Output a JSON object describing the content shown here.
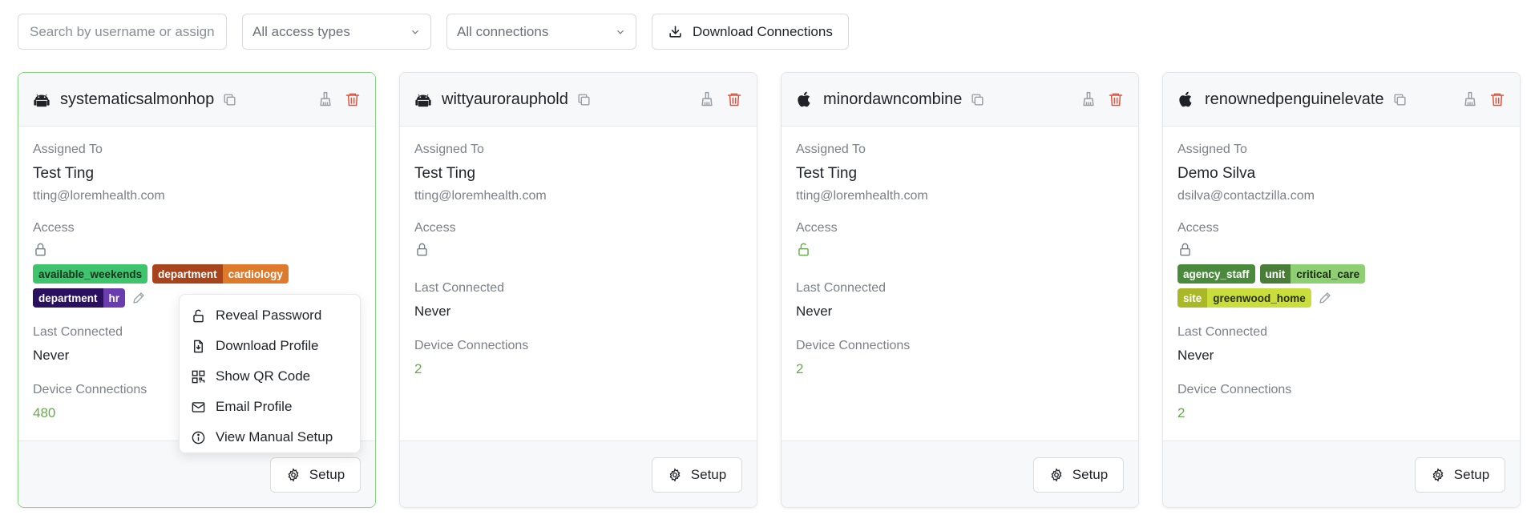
{
  "toolbar": {
    "search_placeholder": "Search by username or assignee",
    "access_select": "All access types",
    "connections_select": "All connections",
    "download_button": "Download Connections"
  },
  "labels": {
    "assigned_to": "Assigned To",
    "access": "Access",
    "last_connected": "Last Connected",
    "device_connections": "Device Connections",
    "setup": "Setup"
  },
  "cards": [
    {
      "name": "systematicsalmonhop",
      "os_icon": "android-icon",
      "assignee_name": "Test Ting",
      "assignee_email": "tting@loremhealth.com",
      "lock_state": "locked",
      "tags": [
        {
          "parts": [
            "available_weekends"
          ],
          "colors": [
            "#3ec46d"
          ],
          "text_colors": [
            "#14331f"
          ]
        },
        {
          "parts": [
            "department",
            "cardiology"
          ],
          "colors": [
            "#a8441c",
            "#dd7a2b"
          ],
          "text_colors": [
            "#ffffff",
            "#ffffff"
          ]
        },
        {
          "parts": [
            "department",
            "hr"
          ],
          "colors": [
            "#2b1060",
            "#6b3bb0"
          ],
          "text_colors": [
            "#ffffff",
            "#ffffff"
          ]
        }
      ],
      "last_connected": "Never",
      "device_connections": "480"
    },
    {
      "name": "wittyaurorauphold",
      "os_icon": "android-icon",
      "assignee_name": "Test Ting",
      "assignee_email": "tting@loremhealth.com",
      "lock_state": "locked",
      "tags": [],
      "last_connected": "Never",
      "device_connections": "2"
    },
    {
      "name": "minordawncombine",
      "os_icon": "apple-icon",
      "assignee_name": "Test Ting",
      "assignee_email": "tting@loremhealth.com",
      "lock_state": "unlocked",
      "tags": [],
      "last_connected": "Never",
      "device_connections": "2"
    },
    {
      "name": "renownedpenguinelevate",
      "os_icon": "apple-icon",
      "assignee_name": "Demo Silva",
      "assignee_email": "dsilva@contactzilla.com",
      "lock_state": "locked",
      "tags": [
        {
          "parts": [
            "agency_staff"
          ],
          "colors": [
            "#4a8a3c"
          ],
          "text_colors": [
            "#ffffff"
          ]
        },
        {
          "parts": [
            "unit",
            "critical_care"
          ],
          "colors": [
            "#4a7d38",
            "#8fcf74"
          ],
          "text_colors": [
            "#ffffff",
            "#1a2a12"
          ]
        },
        {
          "parts": [
            "site",
            "greenwood_home"
          ],
          "colors": [
            "#a9b826",
            "#c9de3c"
          ],
          "text_colors": [
            "#ffffff",
            "#2a3108"
          ]
        }
      ],
      "last_connected": "Never",
      "device_connections": "2"
    }
  ],
  "menu": {
    "items": [
      {
        "label": "Reveal Password",
        "icon": "unlock-icon"
      },
      {
        "label": "Download Profile",
        "icon": "file-download-icon"
      },
      {
        "label": "Show QR Code",
        "icon": "qr-code-icon"
      },
      {
        "label": "Email Profile",
        "icon": "mail-icon"
      },
      {
        "label": "View Manual Setup",
        "icon": "info-icon"
      }
    ]
  },
  "colors": {
    "accent_green": "#6aa84f",
    "delete_red": "#e0533f",
    "selected_border": "#8ccf86"
  }
}
